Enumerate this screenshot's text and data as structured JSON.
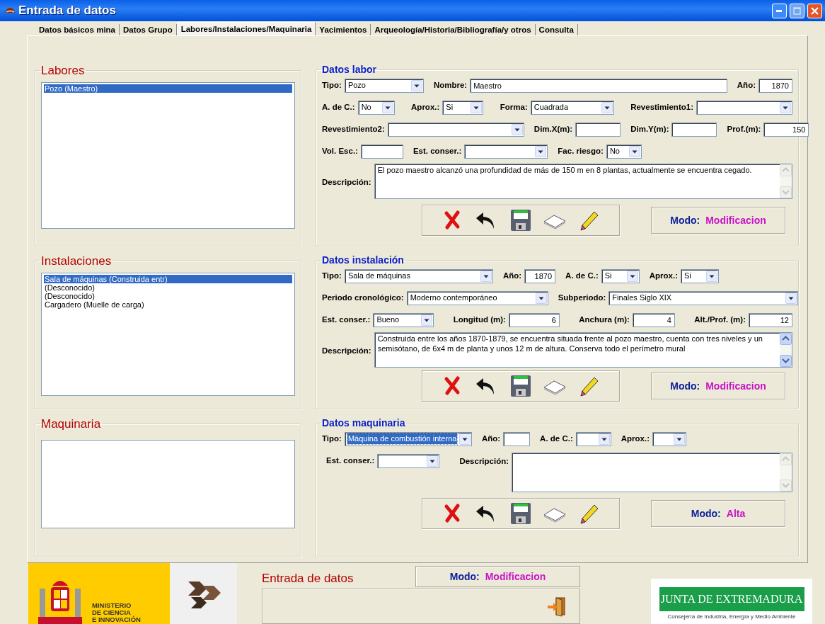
{
  "window": {
    "title": "Entrada de datos"
  },
  "tabs": [
    {
      "label": "Datos básicos mina",
      "selected": false
    },
    {
      "label": "Datos Grupo",
      "selected": false
    },
    {
      "label": "Labores/Instalaciones/Maquinaria",
      "selected": true
    },
    {
      "label": "Yacimientos",
      "selected": false
    },
    {
      "label": "Arqueología/Historia/Bibliografía/y otros",
      "selected": false
    },
    {
      "label": "Consulta",
      "selected": false
    }
  ],
  "sections": [
    {
      "list": {
        "title": "Labores",
        "items": [
          {
            "text": "Pozo (Maestro)",
            "selected": true
          }
        ]
      },
      "detail": {
        "title": "Datos labor",
        "rows": [
          {
            "fields": [
              {
                "kind": "select",
                "label": "Tipo:",
                "value": "Pozo",
                "highlighted": false
              },
              {
                "kind": "text",
                "label": "Nombre:",
                "value": "Maestro"
              },
              {
                "kind": "text",
                "label": "Año:",
                "value": "1870"
              }
            ]
          },
          {
            "fields": [
              {
                "kind": "select",
                "label": "A. de C.:",
                "value": "No",
                "highlighted": false
              },
              {
                "kind": "select",
                "label": "Aprox.:",
                "value": "Si",
                "highlighted": false
              },
              {
                "kind": "select",
                "label": "Forma:",
                "value": "Cuadrada",
                "highlighted": false
              },
              {
                "kind": "select",
                "label": "Revestimiento1:",
                "highlighted": false
              }
            ]
          },
          {
            "fields": [
              {
                "kind": "select",
                "label": "Revestimiento2:",
                "highlighted": false
              },
              {
                "kind": "text",
                "label": "Dim.X(m):"
              },
              {
                "kind": "text",
                "label": "Dim.Y(m):"
              },
              {
                "kind": "text",
                "label": "Prof.(m):",
                "value": "150"
              }
            ]
          },
          {
            "fields": [
              {
                "kind": "text",
                "label": "Vol. Esc.:"
              },
              {
                "kind": "select",
                "label": "Est. conser.:",
                "highlighted": false
              },
              {
                "kind": "select",
                "label": "Fac. riesgo:",
                "value": "No",
                "highlighted": false
              }
            ]
          },
          {
            "fields": [
              {
                "kind": "textarea",
                "label": "Descripción:",
                "value": "El pozo maestro alcanzó una profundidad de más de 150 m en 8 plantas, actualmente se encuentra cegado.",
                "scroll_enabled": false
              }
            ]
          }
        ],
        "mode": {
          "label": "Modo:",
          "value": "Modificacion"
        }
      }
    },
    {
      "list": {
        "title": "Instalaciones",
        "items": [
          {
            "text": "Sala de máquinas (Construida entr)",
            "selected": true
          },
          {
            "text": "(Desconocido)",
            "selected": false
          },
          {
            "text": "(Desconocido)",
            "selected": false
          },
          {
            "text": "Cargadero (Muelle de carga)",
            "selected": false
          }
        ]
      },
      "detail": {
        "title": "Datos instalación",
        "rows": [
          {
            "fields": [
              {
                "kind": "select",
                "label": "Tipo:",
                "value": "Sala de máquinas",
                "highlighted": false
              },
              {
                "kind": "text",
                "label": "Año:",
                "value": "1870"
              },
              {
                "kind": "select",
                "label": "A. de C.:",
                "value": "Si",
                "highlighted": false
              },
              {
                "kind": "select",
                "label": "Aprox.:",
                "value": "Si",
                "highlighted": false
              }
            ]
          },
          {
            "fields": [
              {
                "kind": "select",
                "label": "Periodo cronológico:",
                "value": "Moderno contemporáneo",
                "highlighted": false
              },
              {
                "kind": "select",
                "label": "Subperiodo:",
                "value": "Finales Siglo XIX",
                "highlighted": false
              }
            ]
          },
          {
            "fields": [
              {
                "kind": "select",
                "label": "Est. conser.:",
                "value": "Bueno",
                "highlighted": false
              },
              {
                "kind": "text",
                "label": "Longitud (m):",
                "value": "6"
              },
              {
                "kind": "text",
                "label": "Anchura (m):",
                "value": "4"
              },
              {
                "kind": "text",
                "label": "Alt./Prof. (m):",
                "value": "12"
              }
            ]
          },
          {
            "fields": [
              {
                "kind": "textarea",
                "label": "Descripción:",
                "value": "Construida entre los años 1870-1879, se encuentra situada frente al pozo maestro, cuenta con tres niveles y un semisótano, de 6x4 m de planta y unos 12 m de altura. Conserva todo el perímetro mural",
                "scroll_enabled": true
              }
            ]
          }
        ],
        "mode": {
          "label": "Modo:",
          "value": "Modificacion"
        }
      }
    },
    {
      "list": {
        "title": "Maquinaria"
      },
      "detail": {
        "title": "Datos maquinaria",
        "rows": [
          {
            "fields": [
              {
                "kind": "select",
                "label": "Tipo:",
                "value": "Máquina de combustión interna",
                "highlighted": true
              },
              {
                "kind": "text",
                "label": "Año:"
              },
              {
                "kind": "select",
                "label": "A. de C.:",
                "highlighted": false
              },
              {
                "kind": "select",
                "label": "Aprox.:",
                "highlighted": false
              }
            ]
          },
          {
            "fields": [
              {
                "kind": "select",
                "label": "Est. conser.:",
                "highlighted": false
              },
              {
                "kind": "textarea",
                "label": "Descripción:",
                "scroll_enabled": false
              }
            ]
          }
        ],
        "mode": {
          "label": "Modo:",
          "value": "Alta"
        }
      }
    }
  ],
  "footer": {
    "ministry_lines": [
      "MINISTERIO",
      "DE CIENCIA",
      "E INNOVACIÓN"
    ],
    "title": "Entrada de datos",
    "mode": {
      "label": "Modo:",
      "value": "Modificacion"
    },
    "junta_name": "JUNTA DE EXTREMADURA",
    "junta_subtitle": "Consejería de Industria, Energía y Medio Ambiente"
  }
}
